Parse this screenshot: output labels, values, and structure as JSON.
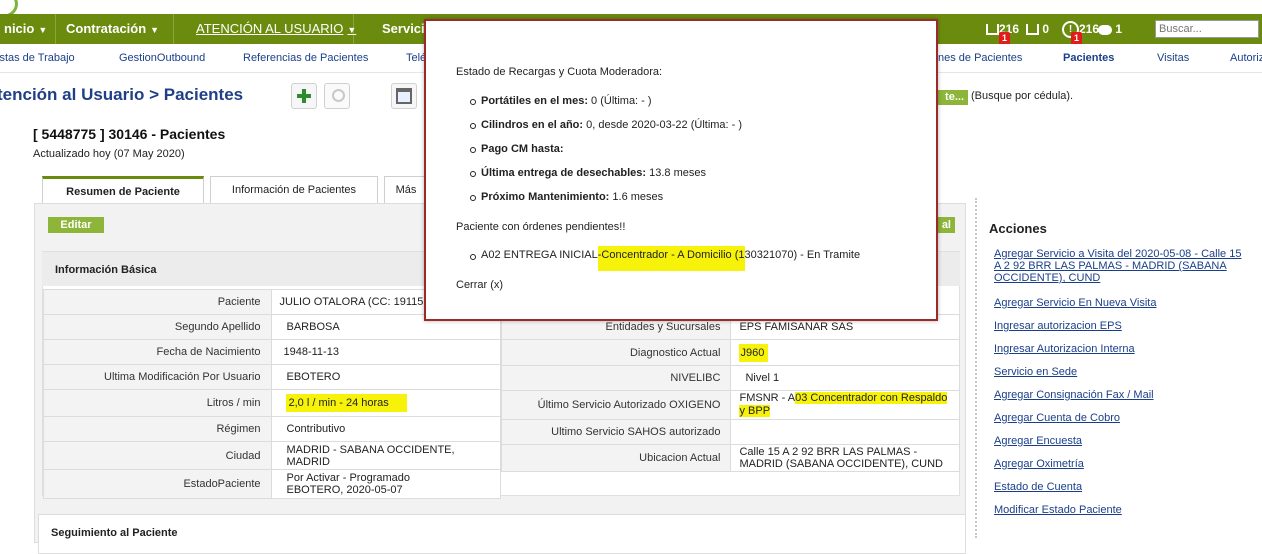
{
  "nav": {
    "items": [
      "nicio",
      "Contratación",
      "ATENCIÓN AL USUARIO",
      "Servici"
    ],
    "counters": [
      "216",
      "0",
      "216",
      "1"
    ],
    "badges": [
      "1",
      "1"
    ],
    "search_placeholder": "Buscar..."
  },
  "subnav": {
    "items": [
      "istas de Trabajo",
      "GestionOutbound",
      "Referencias de Pacientes",
      "Telé",
      "nes de Pacientes",
      "Pacientes",
      "Visitas",
      "Autoriz"
    ]
  },
  "page": {
    "title": "tención al Usuario > Pacientes",
    "find_button": "te...",
    "find_hint": "(Busque por cédula)."
  },
  "patient": {
    "heading": "[ 5448775 ] 30146 - Pacientes",
    "updated": "Actualizado hoy (07 May 2020)"
  },
  "tabs": [
    "Resumen de Paciente",
    "Información de Pacientes",
    "Más"
  ],
  "buttons": {
    "edit": "Editar",
    "right": "al"
  },
  "basic_info": {
    "title": "Información Básica",
    "left_rows": [
      {
        "label": "Paciente",
        "value": "JULIO OTALORA (CC: 191151"
      },
      {
        "label": "Segundo Apellido",
        "value": "BARBOSA"
      },
      {
        "label": "Fecha de Nacimiento",
        "value": "1948-11-13"
      },
      {
        "label": "Ultima Modificación Por Usuario",
        "value": "EBOTERO"
      },
      {
        "label": "Litros / min",
        "value": "2,0 l / min - 24 horas"
      },
      {
        "label": "Régimen",
        "value": "Contributivo"
      },
      {
        "label": "Ciudad",
        "value": "MADRID - SABANA OCCIDENTE, MADRID"
      },
      {
        "label": "EstadoPaciente",
        "value_line1": "Por Activar - Programado",
        "value_line2": "EBOTERO, 2020-05-07"
      }
    ],
    "right_rows": [
      {
        "label": "Entidades y Sucursales",
        "value": "EPS FAMISANAR SAS"
      },
      {
        "label": "Diagnostico Actual",
        "value": "J960"
      },
      {
        "label": "NIVELIBC",
        "value": "Nivel 1"
      },
      {
        "label": "Último Servicio Autorizado OXIGENO",
        "value_a": "FMSNR - A",
        "value_b": "03 Concentrador con Respaldo",
        "value_c": "y BPP"
      },
      {
        "label": "Ultimo Servicio SAHOS autorizado",
        "value": ""
      },
      {
        "label": "Ubicacion Actual",
        "value_line1": "Calle 15 A 2 92 BRR LAS PALMAS -",
        "value_line2": "MADRID (SABANA OCCIDENTE), CUND"
      }
    ]
  },
  "follow_up": {
    "title": "Seguimiento al Paciente"
  },
  "actions": {
    "title": "Acciones",
    "items": [
      "Agregar Servicio a Visita del 2020-05-08 - Calle 15 A 2 92 BRR LAS PALMAS - MADRID (SABANA OCCIDENTE), CUND",
      "Agregar Servicio En Nueva Visita",
      "Ingresar autorizacion EPS",
      "Ingresar Autorizacion Interna",
      "Servicio en Sede",
      "Agregar Consignación Fax / Mail",
      "Agregar Cuenta de Cobro",
      "Agregar Encuesta",
      "Agregar Oximetría",
      "Estado de Cuenta",
      "Modificar Estado Paciente"
    ]
  },
  "modal": {
    "heading": "Estado de Recargas y Cuota Moderadora:",
    "items": [
      {
        "label": "Portátiles en el mes:",
        "value": " 0 (Última: - )"
      },
      {
        "label": "Cilindros en el año:",
        "value": " 0, desde 2020-03-22 (Última: - )"
      },
      {
        "label": "Pago CM hasta:",
        "value": ""
      },
      {
        "label": "Última entrega de desechables:",
        "value": " 13.8 meses"
      },
      {
        "label": "Próximo Mantenimiento:",
        "value": " 1.6 meses"
      }
    ],
    "pending_heading": "Paciente con órdenes pendientes!!",
    "pending_prefix": "A02 ENTREGA INICIAL",
    "pending_highlight": "-Concentrador - A Domicilio (1",
    "pending_suffix": "30321070) - En Tramite",
    "close": "Cerrar (x)"
  },
  "colors": {
    "nav_bg": "#6b8b0e",
    "button": "#8cb53a",
    "highlight": "#f7f20a",
    "modal_border": "#9b2a2a",
    "link": "#1a3f8a"
  }
}
